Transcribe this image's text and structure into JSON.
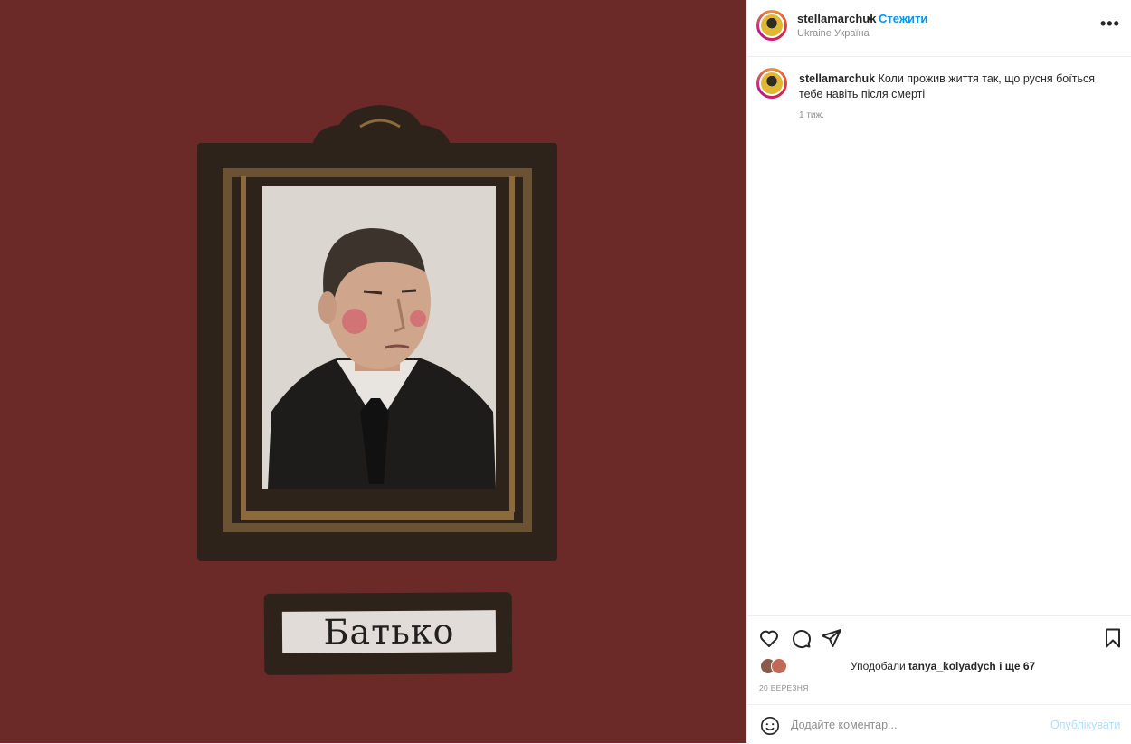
{
  "post": {
    "image_label": "Батько",
    "colors": {
      "background": "#6b2a27",
      "frame": "#2e231b",
      "accent": "#0095f6"
    }
  },
  "header": {
    "username": "stellamarchuk",
    "separator": "•",
    "follow_label": "Стежити",
    "location": "Ukraine Україна",
    "more_icon": "more-horizontal-icon"
  },
  "caption": {
    "username": "stellamarchuk",
    "text": "Коли прожив життя так, що русня боїться тебе навіть після смерті",
    "time": "1 тиж."
  },
  "actions": {
    "icons": [
      "heart-icon",
      "comment-icon",
      "share-icon",
      "bookmark-icon"
    ],
    "likes_prefix": "Уподобали",
    "likes_user": "tanya_kolyadych",
    "likes_suffix": "і ще 67",
    "date": "20 БЕРЕЗНЯ"
  },
  "comment": {
    "emoji_icon": "emoji-icon",
    "placeholder": "Додайте коментар...",
    "publish_label": "Опублікувати"
  }
}
